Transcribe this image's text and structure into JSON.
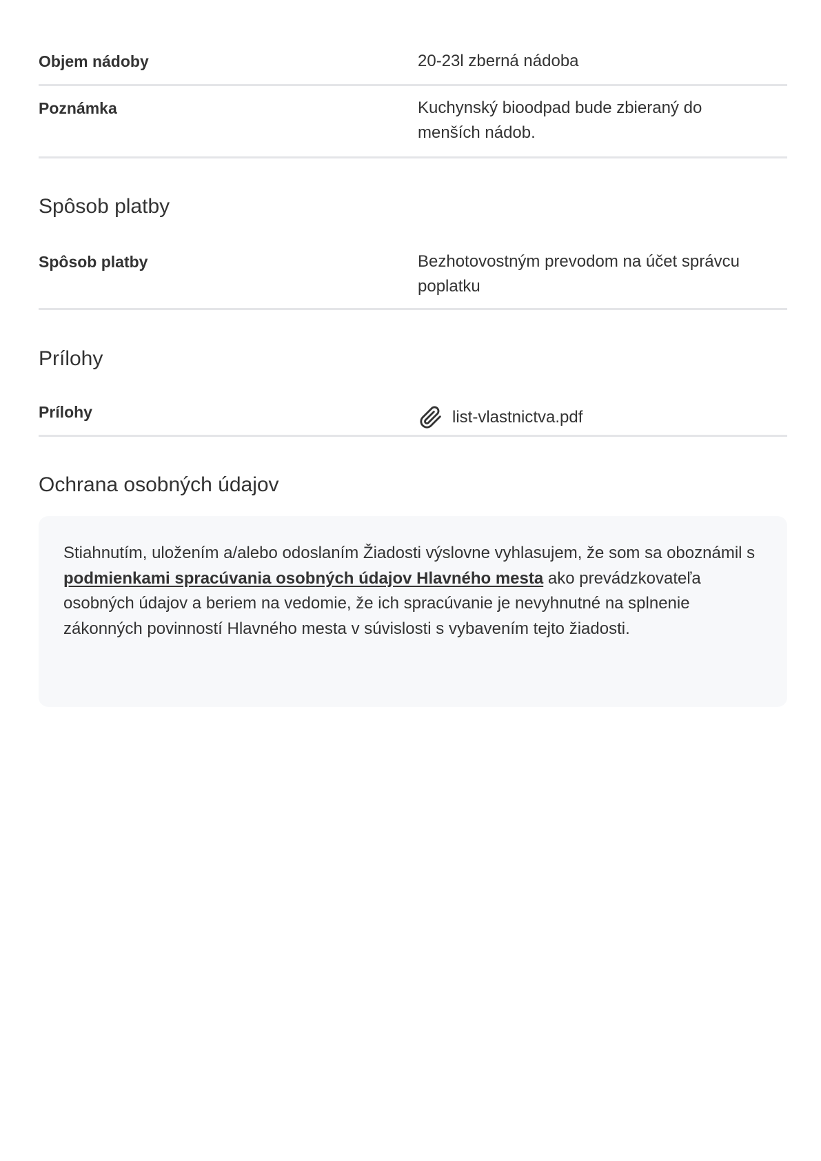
{
  "container_details": {
    "rows": [
      {
        "label": "Objem nádoby",
        "value": "20-23l zberná nádoba"
      },
      {
        "label": "Poznámka",
        "value": "Kuchynský bioodpad bude zbieraný do menších nádob."
      }
    ]
  },
  "payment": {
    "title": "Spôsob platby",
    "rows": [
      {
        "label": "Spôsob platby",
        "value": "Bezhotovostným prevodom na účet správcu poplatku"
      }
    ]
  },
  "attachments": {
    "title": "Prílohy",
    "label": "Prílohy",
    "file_icon": "paperclip-icon",
    "file_name": "list-vlastnictva.pdf"
  },
  "privacy": {
    "title": "Ochrana osobných údajov",
    "text_before": "Stiahnutím, uložením a/alebo odoslaním Žiadosti výslovne vyhlasujem, že som sa oboznámil s ",
    "link_text": "podmienkami spracúvania osobných údajov Hlavného mesta",
    "text_after": " ako prevádzkovateľa osobných údajov a beriem na vedomie, že ich spracúvanie je nevyhnutné na splnenie zákonných povinností Hlavného mesta v súvislosti s vybavením tejto žiadosti."
  },
  "colors": {
    "text": "#333333",
    "divider": "#e4e5e8",
    "notice_background": "#f7f8fa"
  }
}
